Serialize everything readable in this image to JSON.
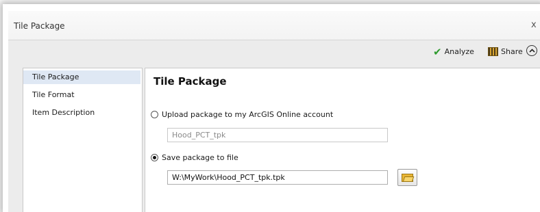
{
  "window": {
    "title": "Tile Package",
    "close_glyph": "x"
  },
  "toolbar": {
    "analyze_label": "Analyze",
    "analyze_icon": "check-icon",
    "share_label": "Share",
    "share_icon": "share-grid-icon",
    "collapse_glyph": "^"
  },
  "nav": {
    "items": [
      {
        "label": "Tile Package",
        "selected": true
      },
      {
        "label": "Tile Format",
        "selected": false
      },
      {
        "label": "Item Description",
        "selected": false
      }
    ]
  },
  "panel": {
    "heading": "Tile Package",
    "upload_option": {
      "label": "Upload package to my ArcGIS Online account",
      "checked": false,
      "value": "Hood_PCT_tpk"
    },
    "save_option": {
      "label": "Save package to file",
      "checked": true,
      "value": "W:\\MyWork\\Hood_PCT_tpk.tpk"
    },
    "browse_icon": "folder-icon"
  },
  "colors": {
    "toolbar_bg": "#ececec",
    "selected_nav_bg": "#dfe8f4",
    "analyze_check": "#2e9b2e"
  }
}
